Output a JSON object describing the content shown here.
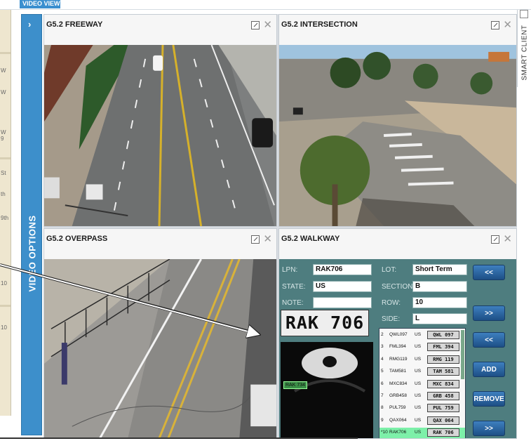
{
  "top_tab": {
    "label": "VIDEO VIEW"
  },
  "map_labels": [
    "W",
    "W",
    "W 9",
    "St",
    "th",
    "9th",
    "10",
    "10"
  ],
  "video_options": {
    "label": "VIDEO OPTIONS",
    "toggle_glyph": "›"
  },
  "smart_client": {
    "label": "SMART CLIENT"
  },
  "tiles": {
    "freeway": {
      "title": "G5.2 FREEWAY"
    },
    "intersection": {
      "title": "G5.2 INTERSECTION"
    },
    "overpass": {
      "title": "G5.2 OVERPASS"
    },
    "walkway": {
      "title": "G5.2 WALKWAY"
    }
  },
  "tile_controls": {
    "close_glyph": "✕"
  },
  "lpr": {
    "lpn_label": "LPN:",
    "lpn_value": "RAK706",
    "state_label": "STATE:",
    "state_value": "US",
    "note_label": "NOTE:",
    "note_value": "",
    "lot_label": "LOT:",
    "lot_value": "Short Term",
    "section_label": "SECTION:",
    "section_value": "B",
    "row_label": "ROW:",
    "row_value": "10",
    "side_label": "SIDE:",
    "side_value": "L",
    "plate_image_text": "RAK 706",
    "ir_tag": "RAK 734",
    "buttons": {
      "prev": "<<",
      "next": ">>",
      "list_prev": "<<",
      "add": "ADD",
      "remove": "REMOVE",
      "list_next": ">>"
    },
    "plate_list": [
      {
        "num": "2",
        "lpn": "QWL097",
        "state": "US",
        "img": "QWL 097"
      },
      {
        "num": "3",
        "lpn": "FML394",
        "state": "US",
        "img": "FML 394"
      },
      {
        "num": "4",
        "lpn": "RMG119",
        "state": "US",
        "img": "RMG 119"
      },
      {
        "num": "5",
        "lpn": "TAM581",
        "state": "US",
        "img": "TAM 581"
      },
      {
        "num": "6",
        "lpn": "MXC834",
        "state": "US",
        "img": "MXC 834"
      },
      {
        "num": "7",
        "lpn": "GRB458",
        "state": "US",
        "img": "GRB 458"
      },
      {
        "num": "8",
        "lpn": "PUL759",
        "state": "US",
        "img": "PUL 759"
      },
      {
        "num": "9",
        "lpn": "QAX064",
        "state": "US",
        "img": "QAX 064"
      },
      {
        "num": "*10",
        "lpn": "RAK706",
        "state": "US",
        "img": "RAK 706",
        "highlighted": true
      }
    ]
  },
  "colors": {
    "accent": "#3d8fcb",
    "panel": "#4e7d7f",
    "highlight": "#7df0a9"
  }
}
